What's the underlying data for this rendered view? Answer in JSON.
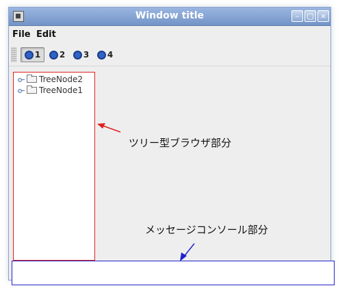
{
  "window": {
    "title": "Window title",
    "controls": [
      {
        "name": "minimize",
        "glyph": "–"
      },
      {
        "name": "maximize",
        "glyph": "▢"
      },
      {
        "name": "close",
        "glyph": "×"
      }
    ]
  },
  "menu": [
    "File",
    "Edit"
  ],
  "toolbar": {
    "buttons": [
      "1",
      "2",
      "3",
      "4"
    ],
    "selected": "1"
  },
  "tree": {
    "nodes": [
      "TreeNode2",
      "TreeNode1"
    ]
  },
  "annotations": {
    "tree_label": "ツリー型ブラウザ部分",
    "console_label": "メッセージコンソール部分"
  },
  "colors": {
    "tree_highlight": "#e02020",
    "console_highlight": "#2222cc",
    "titlebar": "#7e9ed1"
  }
}
